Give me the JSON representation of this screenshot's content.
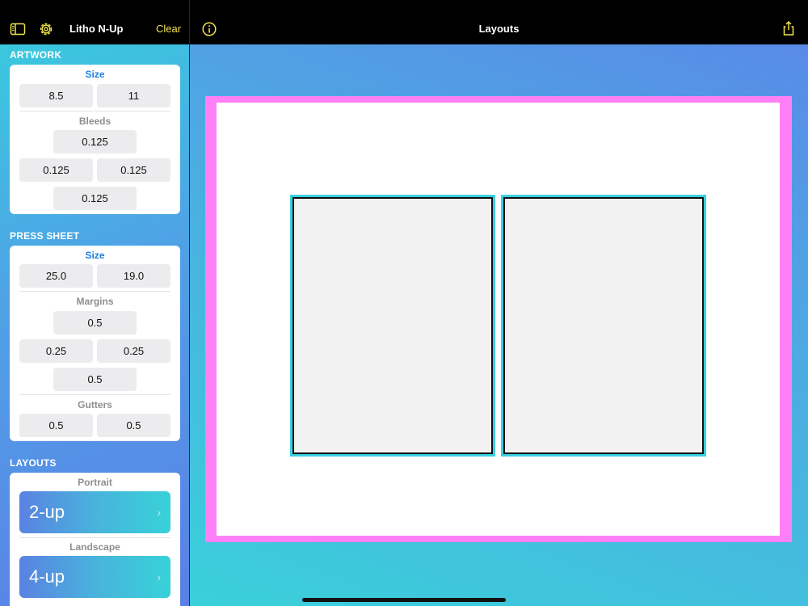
{
  "sidebar": {
    "app_title": "Litho N-Up",
    "clear_label": "Clear",
    "icons": [
      "sidebar-toggle-icon",
      "gear-icon"
    ],
    "artwork": {
      "header": "ARTWORK",
      "size_label": "Size",
      "size_width": "8.5",
      "size_height": "11",
      "bleeds_label": "Bleeds",
      "bleed_top": "0.125",
      "bleed_left": "0.125",
      "bleed_right": "0.125",
      "bleed_bottom": "0.125"
    },
    "press_sheet": {
      "header": "PRESS SHEET",
      "size_label": "Size",
      "size_width": "25.0",
      "size_height": "19.0",
      "margins_label": "Margins",
      "margin_top": "0.5",
      "margin_left": "0.25",
      "margin_right": "0.25",
      "margin_bottom": "0.5",
      "gutters_label": "Gutters",
      "gutter_horizontal": "0.5",
      "gutter_vertical": "0.5"
    },
    "layouts": {
      "header": "LAYOUTS",
      "portrait_label": "Portrait",
      "portrait_value": "2-up",
      "landscape_label": "Landscape",
      "landscape_value": "4-up"
    }
  },
  "main": {
    "title": "Layouts",
    "icons": [
      "info-icon",
      "share-icon"
    ],
    "colors": {
      "press_sheet": "#ff80f6",
      "artwork_bleed": "#3acfe0",
      "accent_yellow": "#f3e34a",
      "label_blue": "#1f7fe0"
    }
  }
}
